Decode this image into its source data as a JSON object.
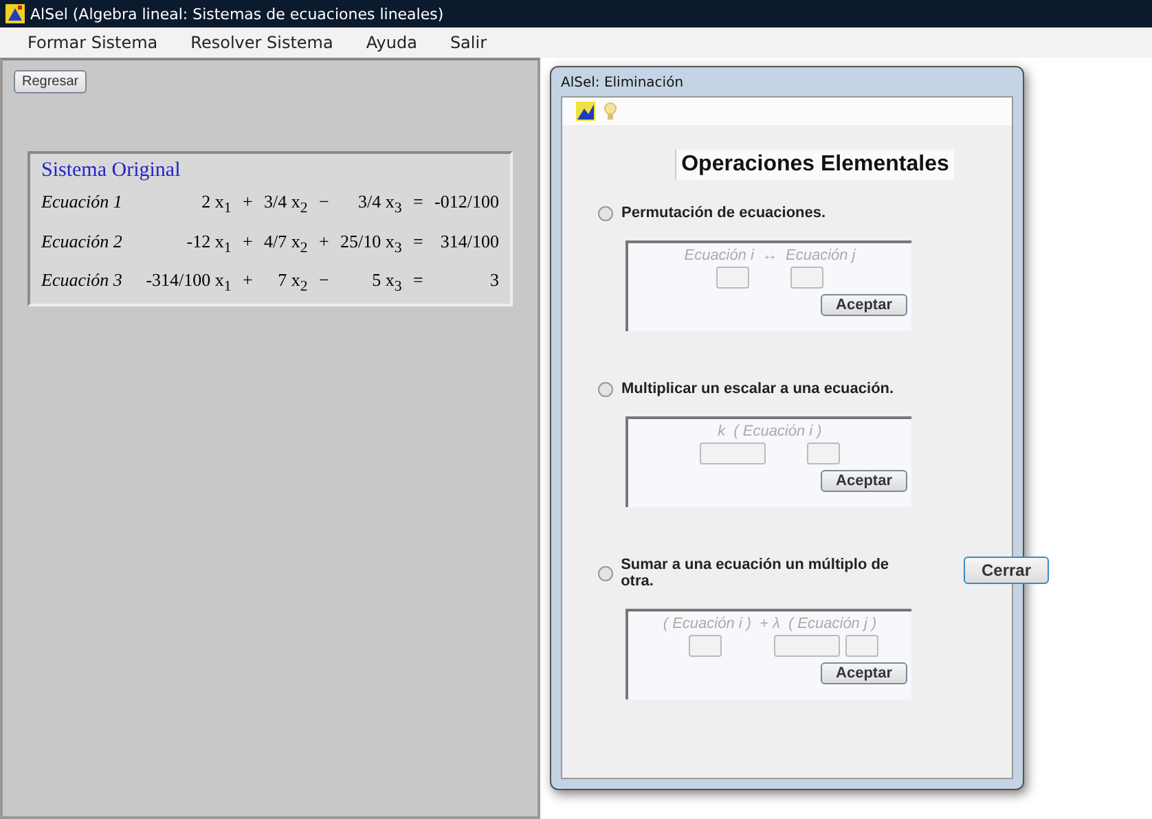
{
  "window": {
    "title": "AlSel (Algebra lineal: Sistemas de ecuaciones lineales)"
  },
  "menu": [
    "Formar Sistema",
    "Resolver Sistema",
    "Ayuda",
    "Salir"
  ],
  "back_button": "Regresar",
  "system": {
    "title": "Sistema Original",
    "equations": [
      {
        "label": "Ecuación 1",
        "parts": [
          "2 x$_{1}$",
          "+",
          "3/4 x$_{2}$",
          "−",
          "3/4 x$_{3}$",
          "=",
          "-012/100"
        ]
      },
      {
        "label": "Ecuación 2",
        "parts": [
          "-12 x$_{1}$",
          "+",
          "4/7 x$_{2}$",
          "+",
          "25/10 x$_{3}$",
          "=",
          "314/100"
        ]
      },
      {
        "label": "Ecuación 3",
        "parts": [
          "-314/100 x$_{1}$",
          "+",
          "7 x$_{2}$",
          "−",
          "5 x$_{3}$",
          "=",
          "3"
        ]
      }
    ]
  },
  "dialog": {
    "title": "AlSel: Eliminación",
    "heading": "Operaciones Elementales",
    "operations": [
      {
        "kind": "permute",
        "label": "Permutación de ecuaciones.",
        "selected": false,
        "hints": [
          "Ecuación i",
          "↔",
          "Ecuación j"
        ],
        "button": "Aceptar"
      },
      {
        "kind": "scale",
        "label": "Multiplicar un escalar a una ecuación.",
        "selected": false,
        "hints": [
          "k",
          "( Ecuación i )"
        ],
        "button": "Aceptar"
      },
      {
        "kind": "add",
        "label": "Sumar a una ecuación un múltiplo de otra.",
        "selected": false,
        "hints": [
          "( Ecuación i )",
          "+ λ",
          "( Ecuación j )"
        ],
        "button": "Aceptar"
      }
    ],
    "close_button": "Cerrar"
  }
}
